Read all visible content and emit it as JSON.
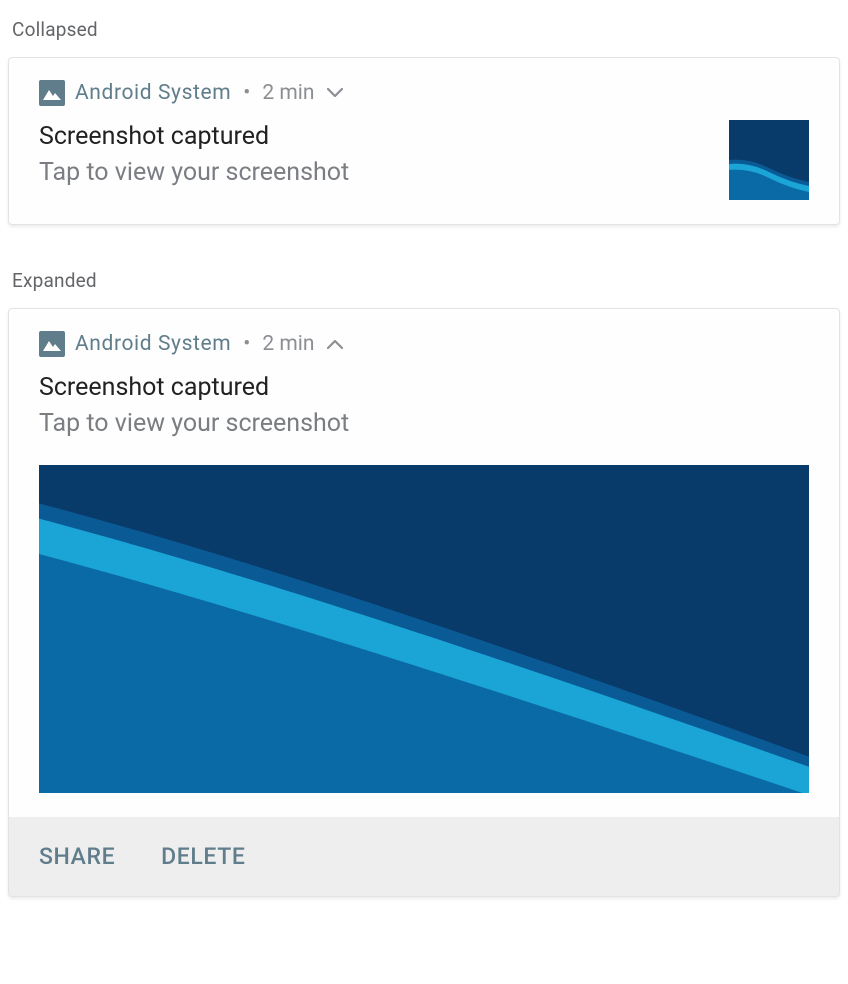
{
  "labels": {
    "collapsed": "Collapsed",
    "expanded": "Expanded"
  },
  "collapsed": {
    "app_name": "Android  System",
    "timestamp": "2 min",
    "separator": "•",
    "title": "Screenshot captured",
    "body": "Tap to view your screenshot",
    "chevron_icon": "chevron-down"
  },
  "expanded": {
    "app_name": "Android  System",
    "timestamp": "2 min",
    "separator": "•",
    "title": "Screenshot captured",
    "body": "Tap to view your screenshot",
    "chevron_icon": "chevron-up",
    "actions": {
      "share": "SHARE",
      "delete": "DELETE"
    }
  },
  "colors": {
    "accent": "#607d8b",
    "bg_dark": "#083a6a",
    "bg_mid": "#0a5a95",
    "bg_light": "#1aa5d6"
  }
}
